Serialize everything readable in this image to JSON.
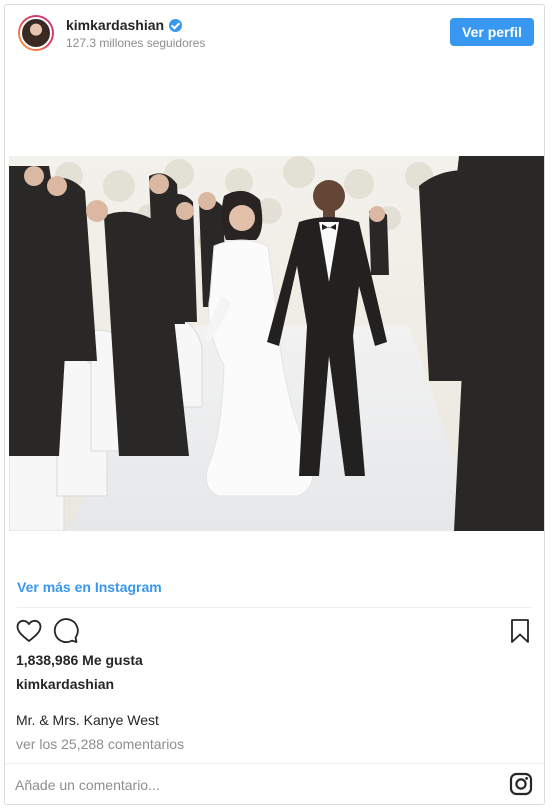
{
  "header": {
    "username": "kimkardashian",
    "followers": "127.3 millones seguidores",
    "view_profile_label": "Ver perfil",
    "verified_icon": "verified-badge-icon"
  },
  "post": {
    "view_more_label": "Ver más en Instagram",
    "likes": "1,838,986 Me gusta",
    "author": "kimkardashian",
    "caption": "Mr. & Mrs. Kanye West",
    "comments_link": "ver los 25,288 comentarios"
  },
  "actions": {
    "like_icon": "heart-icon",
    "comment_icon": "comment-bubble-icon",
    "save_icon": "bookmark-icon"
  },
  "footer": {
    "comment_placeholder": "Añade un comentario...",
    "logo_icon": "instagram-logo-icon"
  },
  "colors": {
    "accent": "#3897f0",
    "text": "#262626",
    "muted": "#8e8e8e",
    "border": "#dbdbdb"
  }
}
